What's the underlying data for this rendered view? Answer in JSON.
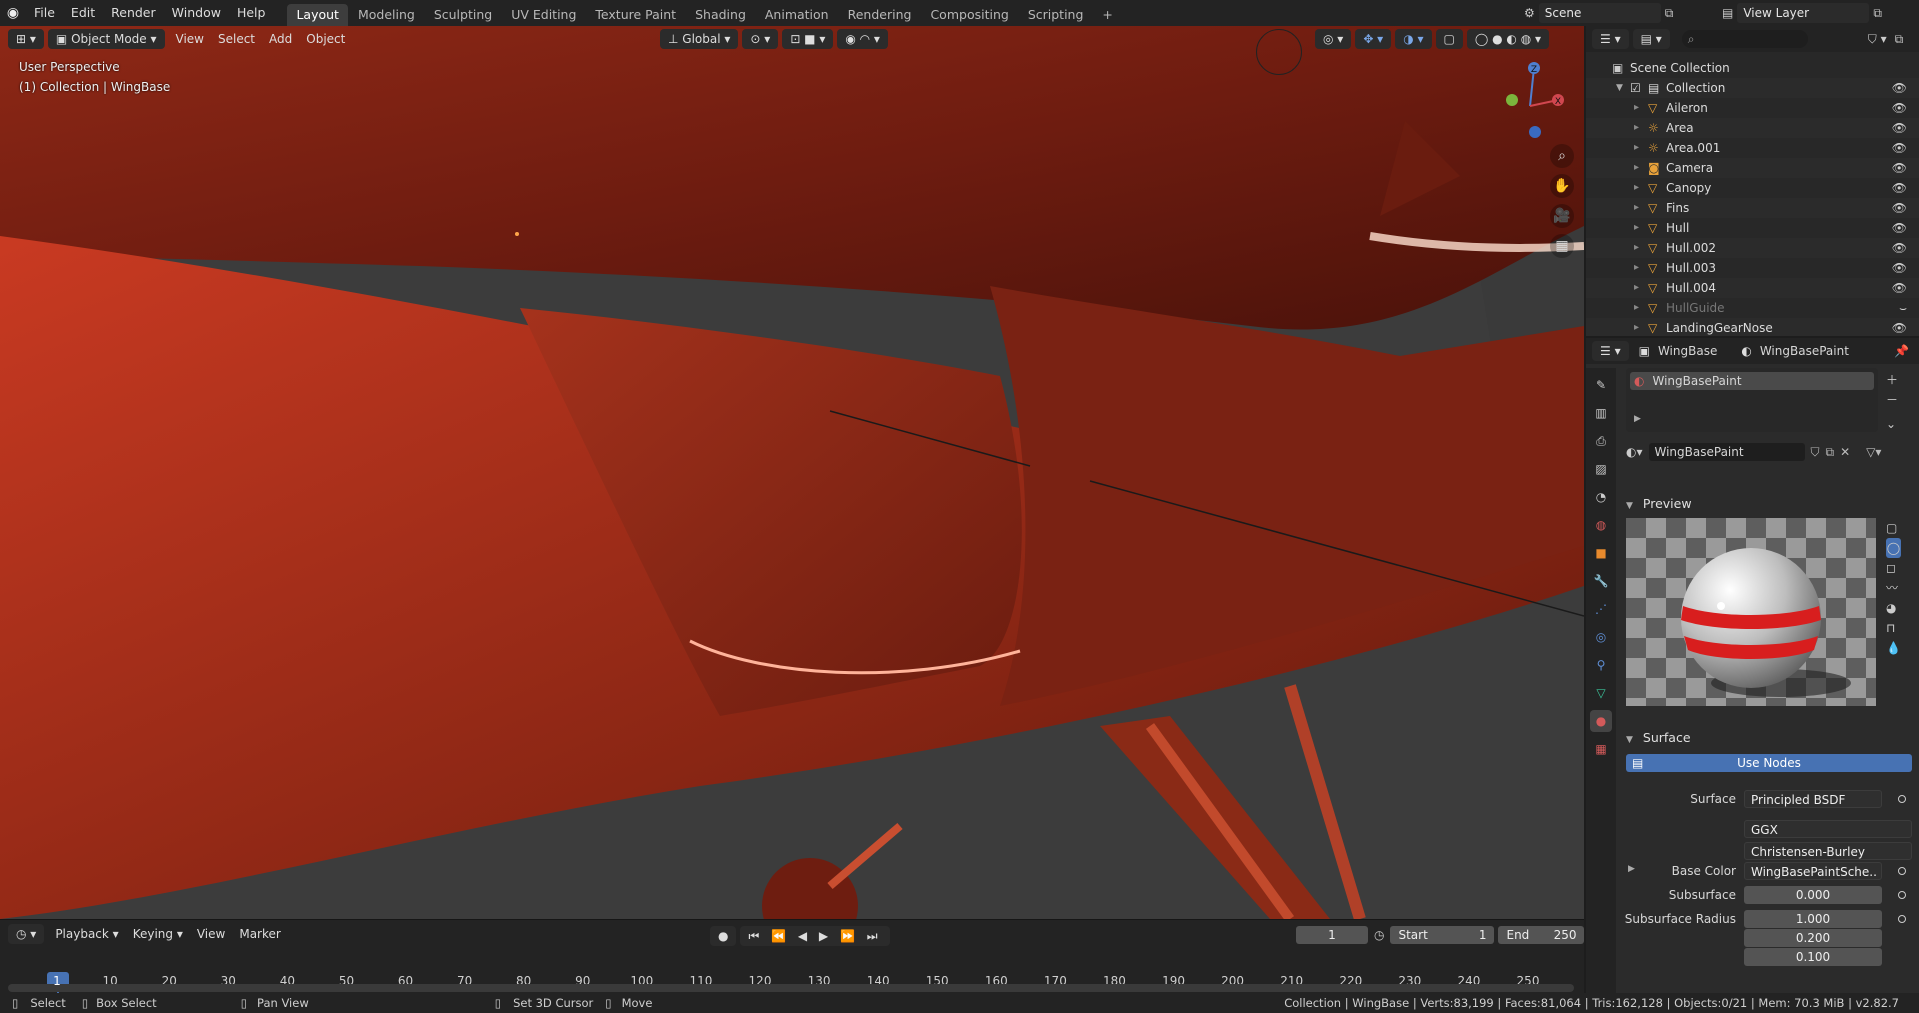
{
  "topbar": {
    "menus": [
      "File",
      "Edit",
      "Render",
      "Window",
      "Help"
    ],
    "workspaces": [
      "Layout",
      "Modeling",
      "Sculpting",
      "UV Editing",
      "Texture Paint",
      "Shading",
      "Animation",
      "Rendering",
      "Compositing",
      "Scripting"
    ],
    "active_workspace": "Layout",
    "add_tab": "+",
    "scene": "Scene",
    "view_layer": "View Layer"
  },
  "viewport": {
    "mode": "Object Mode",
    "menus": [
      "View",
      "Select",
      "Add",
      "Object"
    ],
    "orientation": "Global",
    "overlay_line1": "User Perspective",
    "overlay_line2": "(1) Collection | WingBase",
    "gizmo_axes": {
      "x": "X",
      "y": "Y",
      "z": "Z"
    }
  },
  "outliner": {
    "root": "Scene Collection",
    "collection": "Collection",
    "items": [
      {
        "name": "Aileron",
        "type": "mesh"
      },
      {
        "name": "Area",
        "type": "light"
      },
      {
        "name": "Area.001",
        "type": "light"
      },
      {
        "name": "Camera",
        "type": "camera"
      },
      {
        "name": "Canopy",
        "type": "mesh"
      },
      {
        "name": "Fins",
        "type": "mesh"
      },
      {
        "name": "Hull",
        "type": "mesh"
      },
      {
        "name": "Hull.002",
        "type": "mesh"
      },
      {
        "name": "Hull.003",
        "type": "mesh"
      },
      {
        "name": "Hull.004",
        "type": "mesh"
      },
      {
        "name": "HullGuide",
        "type": "mesh",
        "hidden": true
      },
      {
        "name": "LandingGearNose",
        "type": "mesh"
      }
    ]
  },
  "properties": {
    "object": "WingBase",
    "material": "WingBasePaint",
    "slot_name": "WingBasePaint",
    "material_field": "WingBasePaint",
    "preview_title": "Preview",
    "surface_title": "Surface",
    "use_nodes": "Use Nodes",
    "rows": [
      {
        "label": "Surface",
        "value": "Principled BSDF"
      },
      {
        "label": "",
        "value": "GGX"
      },
      {
        "label": "",
        "value": "Christensen-Burley"
      },
      {
        "label": "Base Color",
        "value": "WingBasePaintSche.."
      },
      {
        "label": "Subsurface",
        "value": "0.000"
      },
      {
        "label": "Subsurface Radius",
        "value": "1.000"
      },
      {
        "label": "",
        "value": "0.200"
      },
      {
        "label": "",
        "value": "0.100"
      }
    ]
  },
  "timeline": {
    "menus": [
      "Playback",
      "Keying",
      "View",
      "Marker"
    ],
    "current_frame": "1",
    "start_label": "Start",
    "start": "1",
    "end_label": "End",
    "end": "250",
    "ticks": [
      "1",
      "10",
      "20",
      "30",
      "40",
      "50",
      "60",
      "70",
      "80",
      "90",
      "100",
      "110",
      "120",
      "130",
      "140",
      "150",
      "160",
      "170",
      "180",
      "190",
      "200",
      "210",
      "220",
      "230",
      "240",
      "250"
    ]
  },
  "statusbar": {
    "select": "Select",
    "box_select": "Box Select",
    "pan_view": "Pan View",
    "set_cursor": "Set 3D Cursor",
    "move": "Move",
    "stats": "Collection | WingBase | Verts:83,199 | Faces:81,064 | Tris:162,128 | Objects:0/21 | Mem: 70.3 MiB | v2.82.7"
  },
  "colors": {
    "accent": "#4772b3",
    "body_red": "#9a2a16",
    "panel_bg": "#2b2b2b"
  }
}
